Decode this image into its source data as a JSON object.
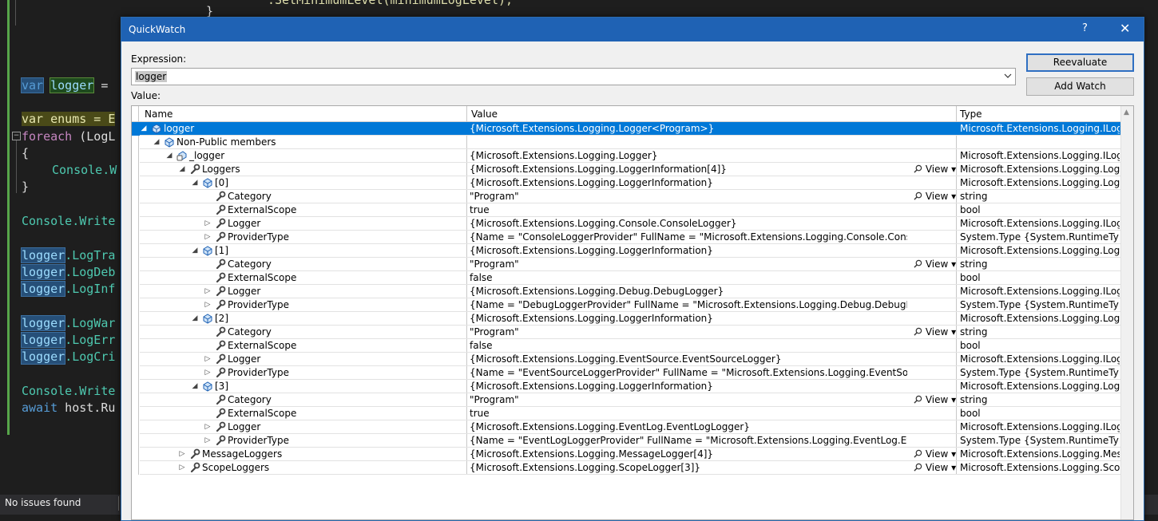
{
  "editor": {
    "line_top": ".SetMinimumLevel(minimumLogLevel);",
    "line_brace": "}",
    "decl_kw": "var",
    "decl_name": "logger",
    "decl_rest": " =",
    "enums_line": "var enums = E",
    "foreach_kw": "foreach",
    "foreach_rest": " (LogL",
    "open_brace": "{",
    "console_w": "Console.W",
    "close_brace": "}",
    "console_write_1": "Console.Write",
    "log_lines": [
      ".LogTra",
      ".LogDeb",
      ".LogInf",
      ".LogWar",
      ".LogErr",
      ".LogCri"
    ],
    "logger_word": "logger",
    "console_write_2": "Console.Write",
    "await_kw": "await",
    "await_rest": " host.Ru"
  },
  "statusbar": {
    "text": "No issues found"
  },
  "dialog": {
    "title": "QuickWatch",
    "help": "?",
    "close": "✕",
    "expression_label": "Expression:",
    "expression_value": "logger",
    "value_label": "Value:",
    "reevaluate_label": "Reevaluate",
    "add_watch_label": "Add Watch",
    "columns": {
      "name": "Name",
      "value": "Value",
      "type": "Type"
    },
    "view_label": "View",
    "rows": [
      {
        "level": 0,
        "exp": "open",
        "icon": "object",
        "name": "logger",
        "value": "{Microsoft.Extensions.Logging.Logger<Program>}",
        "type": "Microsoft.Extensions.Logging.ILogg...",
        "view": false,
        "selected": true
      },
      {
        "level": 1,
        "exp": "open",
        "icon": "object",
        "name": "Non-Public members",
        "value": "",
        "type": "",
        "view": false
      },
      {
        "level": 2,
        "exp": "open",
        "icon": "private-field",
        "name": "_logger",
        "value": "{Microsoft.Extensions.Logging.Logger}",
        "type": "Microsoft.Extensions.Logging.ILogg...",
        "view": false
      },
      {
        "level": 3,
        "exp": "open",
        "icon": "wrench",
        "name": "Loggers",
        "value": "{Microsoft.Extensions.Logging.LoggerInformation[4]}",
        "type": "Microsoft.Extensions.Logging.Logg...",
        "view": true
      },
      {
        "level": 4,
        "exp": "open",
        "icon": "object",
        "name": "[0]",
        "value": "{Microsoft.Extensions.Logging.LoggerInformation}",
        "type": "Microsoft.Extensions.Logging.Logg...",
        "view": false
      },
      {
        "level": 5,
        "exp": "none",
        "icon": "wrench",
        "name": "Category",
        "value": "\"Program\"",
        "type": "string",
        "view": true
      },
      {
        "level": 5,
        "exp": "none",
        "icon": "wrench",
        "name": "ExternalScope",
        "value": "true",
        "type": "bool",
        "view": false
      },
      {
        "level": 5,
        "exp": "closed",
        "icon": "wrench",
        "name": "Logger",
        "value": "{Microsoft.Extensions.Logging.Console.ConsoleLogger}",
        "type": "Microsoft.Extensions.Logging.ILogg...",
        "view": false
      },
      {
        "level": 5,
        "exp": "closed",
        "icon": "wrench",
        "name": "ProviderType",
        "value": "{Name = \"ConsoleLoggerProvider\" FullName = \"Microsoft.Extensions.Logging.Console.ConsoleLoggerProvider\"}",
        "type": "System.Type {System.RuntimeType}",
        "view": false
      },
      {
        "level": 4,
        "exp": "open",
        "icon": "object",
        "name": "[1]",
        "value": "{Microsoft.Extensions.Logging.LoggerInformation}",
        "type": "Microsoft.Extensions.Logging.Logg...",
        "view": false
      },
      {
        "level": 5,
        "exp": "none",
        "icon": "wrench",
        "name": "Category",
        "value": "\"Program\"",
        "type": "string",
        "view": true
      },
      {
        "level": 5,
        "exp": "none",
        "icon": "wrench",
        "name": "ExternalScope",
        "value": "false",
        "type": "bool",
        "view": false
      },
      {
        "level": 5,
        "exp": "closed",
        "icon": "wrench",
        "name": "Logger",
        "value": "{Microsoft.Extensions.Logging.Debug.DebugLogger}",
        "type": "Microsoft.Extensions.Logging.ILogg...",
        "view": false
      },
      {
        "level": 5,
        "exp": "closed",
        "icon": "wrench",
        "name": "ProviderType",
        "value": "{Name = \"DebugLoggerProvider\" FullName = \"Microsoft.Extensions.Logging.Debug.DebugLoggerProvider\"}",
        "type": "System.Type {System.RuntimeType}",
        "view": false
      },
      {
        "level": 4,
        "exp": "open",
        "icon": "object",
        "name": "[2]",
        "value": "{Microsoft.Extensions.Logging.LoggerInformation}",
        "type": "Microsoft.Extensions.Logging.Logg...",
        "view": false
      },
      {
        "level": 5,
        "exp": "none",
        "icon": "wrench",
        "name": "Category",
        "value": "\"Program\"",
        "type": "string",
        "view": true
      },
      {
        "level": 5,
        "exp": "none",
        "icon": "wrench",
        "name": "ExternalScope",
        "value": "false",
        "type": "bool",
        "view": false
      },
      {
        "level": 5,
        "exp": "closed",
        "icon": "wrench",
        "name": "Logger",
        "value": "{Microsoft.Extensions.Logging.EventSource.EventSourceLogger}",
        "type": "Microsoft.Extensions.Logging.ILogg...",
        "view": false
      },
      {
        "level": 5,
        "exp": "closed",
        "icon": "wrench",
        "name": "ProviderType",
        "value": "{Name = \"EventSourceLoggerProvider\" FullName = \"Microsoft.Extensions.Logging.EventSource.EventSourceLogg...",
        "type": "System.Type {System.RuntimeType}",
        "view": false
      },
      {
        "level": 4,
        "exp": "open",
        "icon": "object",
        "name": "[3]",
        "value": "{Microsoft.Extensions.Logging.LoggerInformation}",
        "type": "Microsoft.Extensions.Logging.Logg...",
        "view": false
      },
      {
        "level": 5,
        "exp": "none",
        "icon": "wrench",
        "name": "Category",
        "value": "\"Program\"",
        "type": "string",
        "view": true
      },
      {
        "level": 5,
        "exp": "none",
        "icon": "wrench",
        "name": "ExternalScope",
        "value": "true",
        "type": "bool",
        "view": false
      },
      {
        "level": 5,
        "exp": "closed",
        "icon": "wrench",
        "name": "Logger",
        "value": "{Microsoft.Extensions.Logging.EventLog.EventLogLogger}",
        "type": "Microsoft.Extensions.Logging.ILogg...",
        "view": false
      },
      {
        "level": 5,
        "exp": "closed",
        "icon": "wrench",
        "name": "ProviderType",
        "value": "{Name = \"EventLogLoggerProvider\" FullName = \"Microsoft.Extensions.Logging.EventLog.EventLogLoggerProvid...",
        "type": "System.Type {System.RuntimeType}",
        "view": false
      },
      {
        "level": 3,
        "exp": "closed",
        "icon": "wrench",
        "name": "MessageLoggers",
        "value": "{Microsoft.Extensions.Logging.MessageLogger[4]}",
        "type": "Microsoft.Extensions.Logging.Mess...",
        "view": true
      },
      {
        "level": 3,
        "exp": "closed",
        "icon": "wrench",
        "name": "ScopeLoggers",
        "value": "{Microsoft.Extensions.Logging.ScopeLogger[3]}",
        "type": "Microsoft.Extensions.Logging.Scop...",
        "view": true
      }
    ]
  },
  "colors": {
    "title_bar": "#1f62b4",
    "selection": "#0078d7",
    "editor_bg": "#1e1e1e"
  }
}
